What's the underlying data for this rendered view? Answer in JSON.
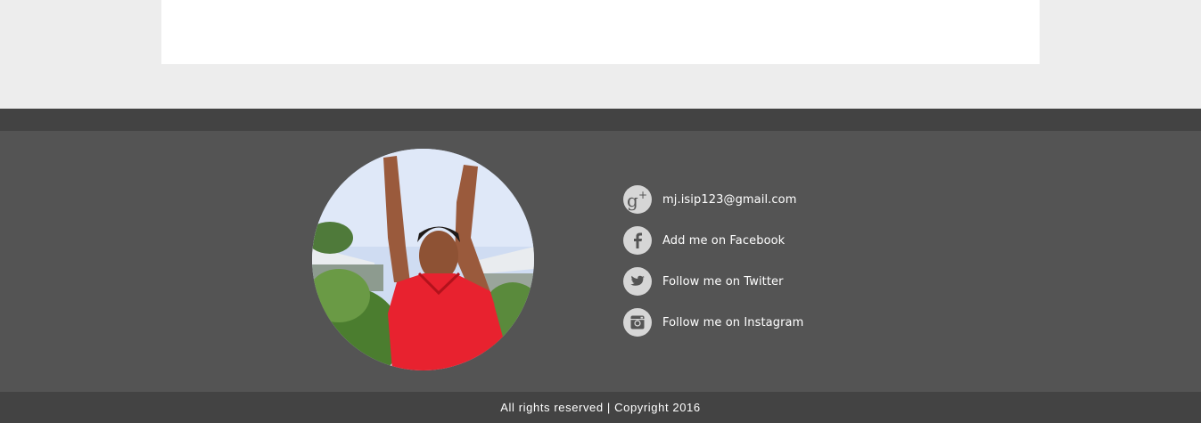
{
  "colors": {
    "page_bg": "#ededed",
    "panel_bg": "#ffffff",
    "footer_dark": "#434343",
    "footer_main": "#545454",
    "icon_bg": "#d6d6d6",
    "icon_fg": "#545454",
    "text": "#ffffff"
  },
  "profile": {
    "photo_icon": "profile-photo"
  },
  "contacts": [
    {
      "icon": "google-plus-icon",
      "label": "mj.isip123@gmail.com"
    },
    {
      "icon": "facebook-icon",
      "label": "Add me on Facebook"
    },
    {
      "icon": "twitter-icon",
      "label": "Follow me on Twitter"
    },
    {
      "icon": "instagram-icon",
      "label": "Follow me on Instagram"
    }
  ],
  "footer": {
    "copyright": "All rights reserved | Copyright 2016"
  }
}
